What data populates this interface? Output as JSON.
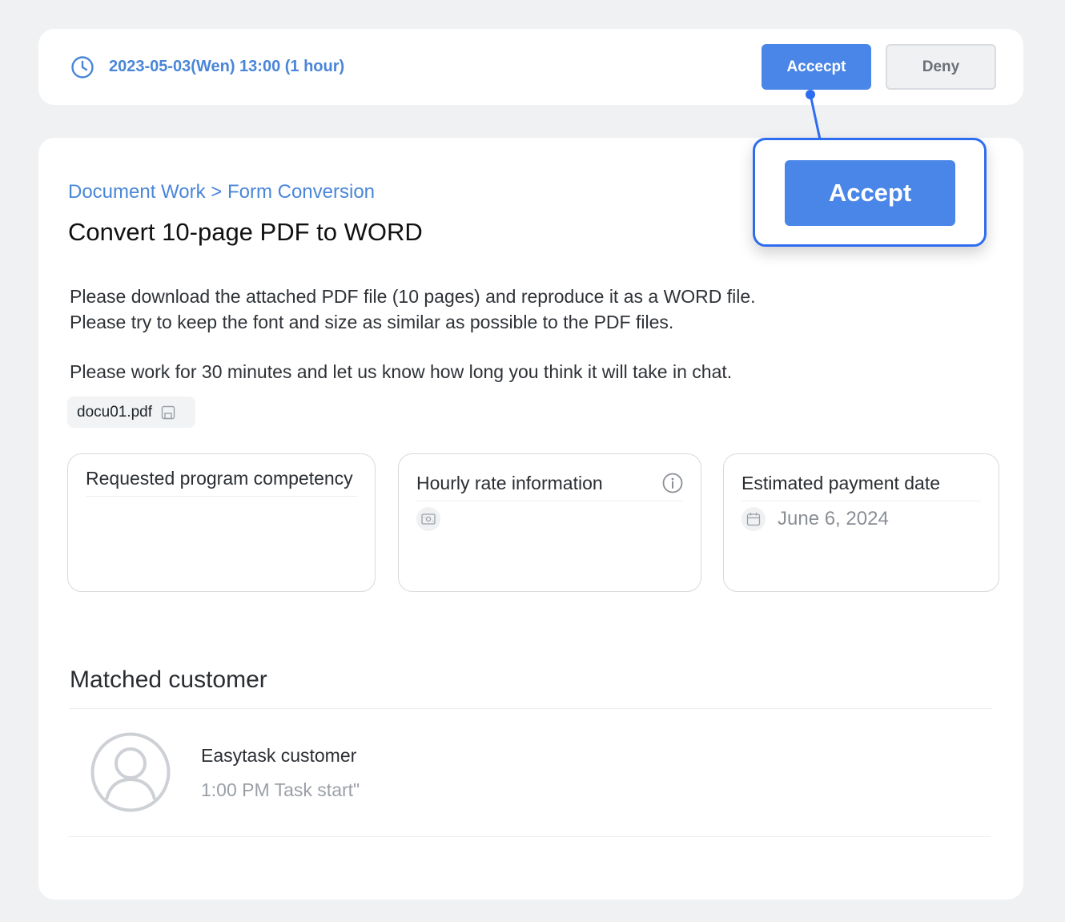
{
  "header": {
    "schedule": "2023-05-03(Wen) 13:00 (1 hour)",
    "accept_label": "Accecpt",
    "deny_label": "Deny"
  },
  "callout": {
    "accept_label": "Accept"
  },
  "task": {
    "breadcrumb": "Document Work > Form Conversion",
    "title": "Convert 10-page PDF to WORD",
    "description_lines": [
      "Please download the attached PDF file (10 pages) and reproduce it as a WORD file.",
      "Please try to keep the font and size as similar as possible to the PDF files.",
      "Please work for 30 minutes and let us know how long you think it will take in chat."
    ],
    "attachment": "docu01.pdf"
  },
  "info": {
    "competency_title": "Requested program competency",
    "rate_title": "Hourly rate information",
    "payment_title": "Estimated payment date",
    "payment_date": "June 6, 2024"
  },
  "customer": {
    "section_title": "Matched customer",
    "name": "Easytask customer",
    "status": "1:00 PM Task start\""
  },
  "colors": {
    "accent": "#4a86e8",
    "callout_border": "#2f6df0",
    "link_text": "#4a86d8"
  },
  "icons": [
    "clock-icon",
    "save-icon",
    "info-icon",
    "money-icon",
    "calendar-icon",
    "user-avatar-icon"
  ]
}
